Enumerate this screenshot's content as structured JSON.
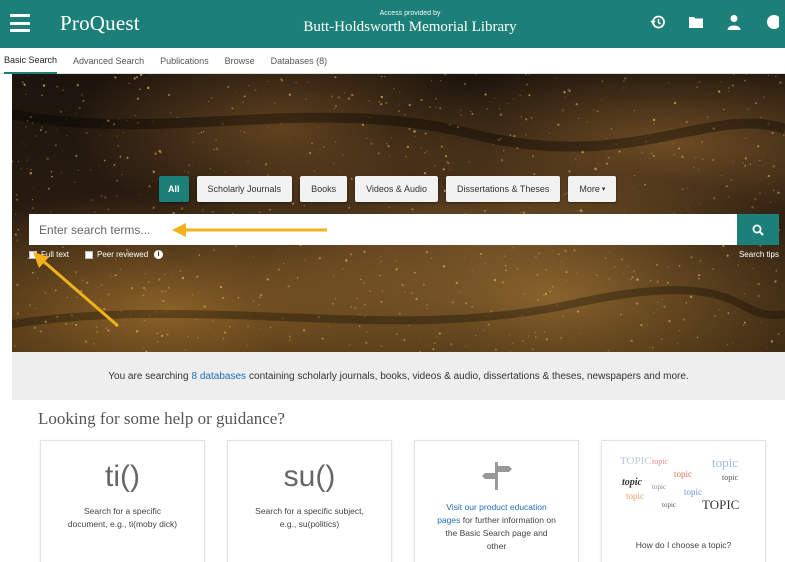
{
  "header": {
    "logo": "ProQuest",
    "access_label": "Access provided by",
    "library_name": "Butt-Holdsworth Memorial Library",
    "icons": [
      "history-icon",
      "folder-icon",
      "user-icon",
      "globe-icon"
    ]
  },
  "nav": {
    "tabs": [
      "Basic Search",
      "Advanced Search",
      "Publications",
      "Browse",
      "Databases (8)"
    ],
    "active": "Basic Search"
  },
  "search": {
    "source_types": [
      "All",
      "Scholarly Journals",
      "Books",
      "Videos & Audio",
      "Dissertations & Theses",
      "More"
    ],
    "active_type": "All",
    "placeholder": "Enter search terms...",
    "full_text_label": "Full text",
    "peer_reviewed_label": "Peer reviewed",
    "search_tips": "Search tips"
  },
  "info_bar": {
    "prefix": "You are searching",
    "link": "8 databases",
    "suffix": "containing scholarly journals, books, videos & audio, dissertations & theses, newspapers and more."
  },
  "help": {
    "title": "Looking for some help or guidance?",
    "cards": [
      {
        "symbol": "ti()",
        "text": "Search for a specific document, e.g., ti(moby dick)"
      },
      {
        "symbol": "su()",
        "text": "Search for a specific subject, e.g., su(politics)"
      },
      {
        "link": "Visit our product education pages",
        "text": "for further information on the Basic Search page and other"
      },
      {
        "text": "How do I choose a topic?"
      }
    ],
    "wordcloud": [
      "TOPIC",
      "topic",
      "topic",
      "topic",
      "topic",
      "topic",
      "topic",
      "topic",
      "topic",
      "TOPIC",
      "topic"
    ]
  },
  "colors": {
    "brand": "#1d8078",
    "link": "#1f6fb2",
    "arrow": "#f2b21b"
  }
}
